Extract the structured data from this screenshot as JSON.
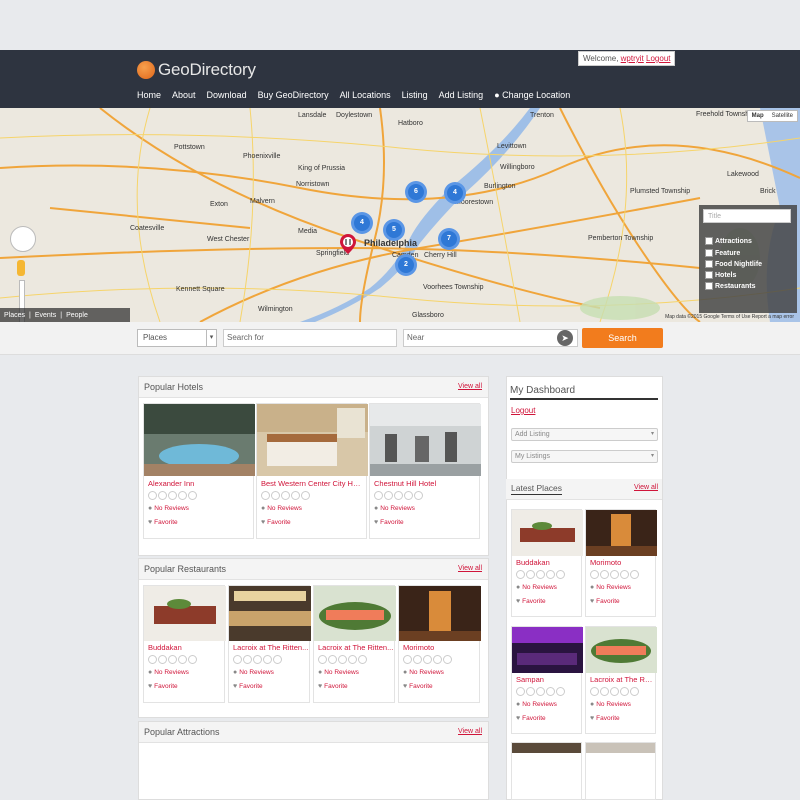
{
  "header": {
    "logo_text": "GeoDirectory",
    "welcome_prefix": "Welcome,",
    "welcome_user": "wptryit",
    "welcome_logout": "Logout",
    "nav": [
      "Home",
      "About",
      "Download",
      "Buy GeoDirectory",
      "All Locations",
      "Listing",
      "Add Listing",
      "Change Location"
    ]
  },
  "map": {
    "type_buttons": [
      "Map",
      "Satellite"
    ],
    "legend_placeholder": "Title",
    "legend_items": [
      "Attractions",
      "Feature",
      "Food Nightlife",
      "Hotels",
      "Restaurants"
    ],
    "tabs": [
      "Places",
      "Events",
      "People"
    ],
    "credit": "Map data ©2015 Google   Terms of Use   Report a map error",
    "cities": [
      "Trenton",
      "Levittown",
      "Philadelphia",
      "Cherry Hill",
      "Camden",
      "Norristown",
      "West Chester",
      "Coatesville",
      "Moorestown",
      "Burlington",
      "Willingboro",
      "Lakewood",
      "Brick",
      "Freehold Township",
      "Plumsted Township",
      "Pemberton Township",
      "Wilmington",
      "Media",
      "Springfield",
      "Voorhees Township",
      "Phoenixville",
      "King of Prussia",
      "Kennett Square",
      "Glassboro",
      "Hatboro",
      "Doylestown",
      "Lansdale",
      "Pottstown",
      "Exton",
      "Malvern"
    ],
    "clusters": [
      "6",
      "4",
      "4",
      "5",
      "7",
      "2"
    ]
  },
  "search": {
    "type_value": "Places",
    "for_placeholder": "Search for",
    "near_placeholder": "Near",
    "button": "Search"
  },
  "hotels": {
    "title": "Popular Hotels",
    "view_all": "View all",
    "items": [
      {
        "name": "Alexander Inn",
        "reviews": "No Reviews",
        "favorite": "Favorite"
      },
      {
        "name": "Best Western Center City Hotel",
        "reviews": "No Reviews",
        "favorite": "Favorite"
      },
      {
        "name": "Chestnut Hill Hotel",
        "reviews": "No Reviews",
        "favorite": "Favorite"
      }
    ]
  },
  "restaurants": {
    "title": "Popular Restaurants",
    "view_all": "View all",
    "items": [
      {
        "name": "Buddakan",
        "reviews": "No Reviews",
        "favorite": "Favorite"
      },
      {
        "name": "Lacroix at The Ritten...",
        "reviews": "No Reviews",
        "favorite": "Favorite"
      },
      {
        "name": "Lacroix at The Ritten...",
        "reviews": "No Reviews",
        "favorite": "Favorite"
      },
      {
        "name": "Morimoto",
        "reviews": "No Reviews",
        "favorite": "Favorite"
      }
    ]
  },
  "attractions": {
    "title": "Popular Attractions",
    "view_all": "View all"
  },
  "dashboard": {
    "title": "My Dashboard",
    "logout": "Logout",
    "add_listing": "Add Listing",
    "my_listings": "My Listings"
  },
  "latest": {
    "title": "Latest Places",
    "view_all": "View all",
    "items": [
      {
        "name": "Buddakan",
        "reviews": "No Reviews",
        "favorite": "Favorite"
      },
      {
        "name": "Morimoto",
        "reviews": "No Reviews",
        "favorite": "Favorite"
      },
      {
        "name": "Sampan",
        "reviews": "No Reviews",
        "favorite": "Favorite"
      },
      {
        "name": "Lacroix at The Rit...",
        "reviews": "No Reviews",
        "favorite": "Favorite"
      }
    ]
  },
  "colors": {
    "header_bg": "#2e3440",
    "accent": "#d0153a",
    "search_button": "#f27c1d"
  }
}
